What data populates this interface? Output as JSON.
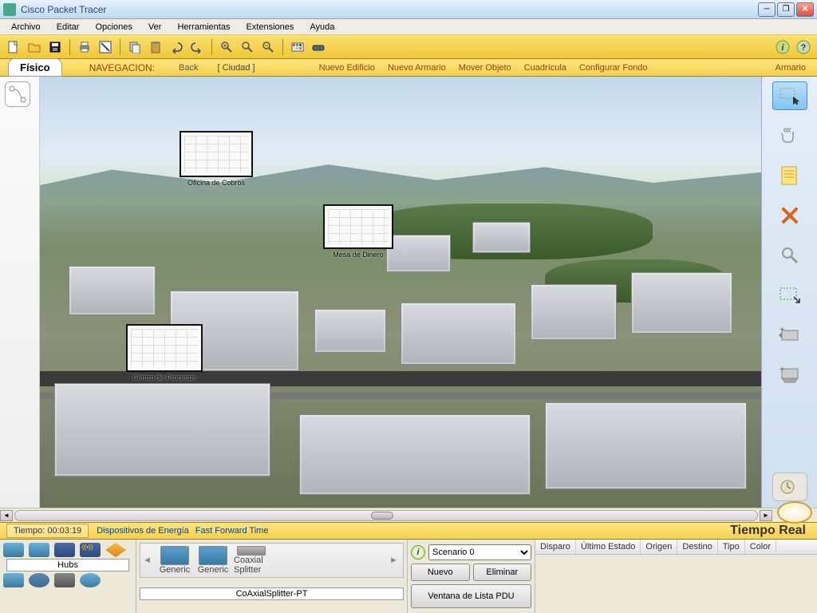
{
  "window": {
    "title": "Cisco Packet Tracer"
  },
  "menu": {
    "items": [
      "Archivo",
      "Editar",
      "Opciones",
      "Ver",
      "Herramientas",
      "Extensiones",
      "Ayuda"
    ]
  },
  "subnav": {
    "tab": "Físico",
    "nav_label": "NAVEGACION:",
    "back": "Back",
    "location": "[ Ciudad ]",
    "actions": [
      "Nuevo Edificio",
      "Nuevo Armario",
      "Mover Objeto",
      "Cuadrícula",
      "Configurar Fondo"
    ],
    "right": "Armario"
  },
  "wiring_closets": [
    {
      "label": "Oficina de Cobros"
    },
    {
      "label": "Mesa de Dinero"
    },
    {
      "label": "Centro de Procesos"
    }
  ],
  "status": {
    "time_label": "Tiempo:",
    "time_value": "00:03:19",
    "power_link": "Dispositivos de Energía",
    "fft_link": "Fast Forward Time",
    "realtime": "Tiempo Real"
  },
  "device_category_label": "Hubs",
  "device_items": [
    "Generic",
    "Generic",
    "Coaxial Splitter"
  ],
  "selected_device": "CoAxialSplitter-PT",
  "scenario": {
    "selected": "Scenario 0",
    "new_btn": "Nuevo",
    "del_btn": "Eliminar",
    "list_btn": "Ventana de Lista PDU"
  },
  "pdu_headers": [
    "Disparo",
    "Último Estado",
    "Origen",
    "Destino",
    "Tipo",
    "Color"
  ]
}
